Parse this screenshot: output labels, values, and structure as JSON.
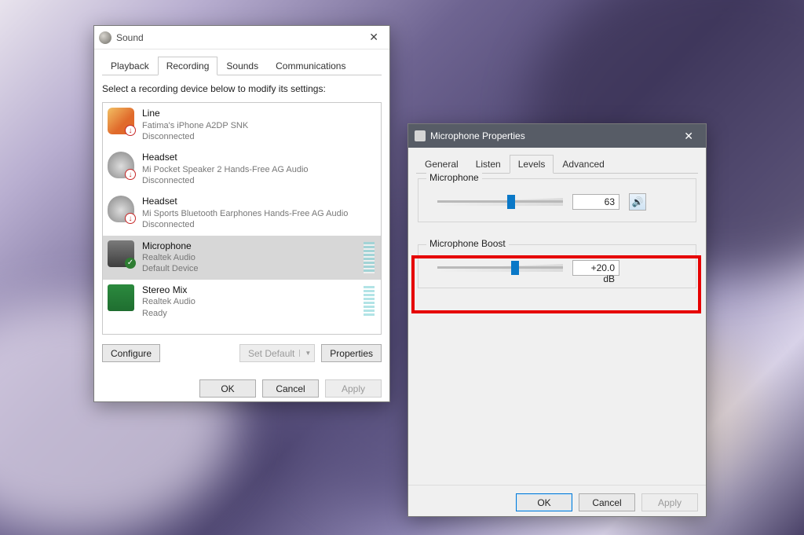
{
  "sound": {
    "title": "Sound",
    "tabs": {
      "playback": "Playback",
      "recording": "Recording",
      "sounds": "Sounds",
      "communications": "Communications"
    },
    "instruction": "Select a recording device below to modify its settings:",
    "devices": [
      {
        "name": "Line",
        "desc": "Fatima's iPhone A2DP SNK",
        "status": "Disconnected"
      },
      {
        "name": "Headset",
        "desc": "Mi Pocket Speaker 2 Hands-Free AG Audio",
        "status": "Disconnected"
      },
      {
        "name": "Headset",
        "desc": "Mi Sports Bluetooth Earphones Hands-Free AG Audio",
        "status": "Disconnected"
      },
      {
        "name": "Microphone",
        "desc": "Realtek Audio",
        "status": "Default Device"
      },
      {
        "name": "Stereo Mix",
        "desc": "Realtek Audio",
        "status": "Ready"
      }
    ],
    "buttons": {
      "configure": "Configure",
      "setDefault": "Set Default",
      "properties": "Properties",
      "ok": "OK",
      "cancel": "Cancel",
      "apply": "Apply"
    }
  },
  "mic": {
    "title": "Microphone Properties",
    "tabs": {
      "general": "General",
      "listen": "Listen",
      "levels": "Levels",
      "advanced": "Advanced"
    },
    "microphone": {
      "label": "Microphone",
      "value": "63",
      "sliderPct": 59
    },
    "boost": {
      "label": "Microphone Boost",
      "value": "+20.0 dB",
      "sliderPct": 62
    },
    "buttons": {
      "ok": "OK",
      "cancel": "Cancel",
      "apply": "Apply"
    }
  }
}
